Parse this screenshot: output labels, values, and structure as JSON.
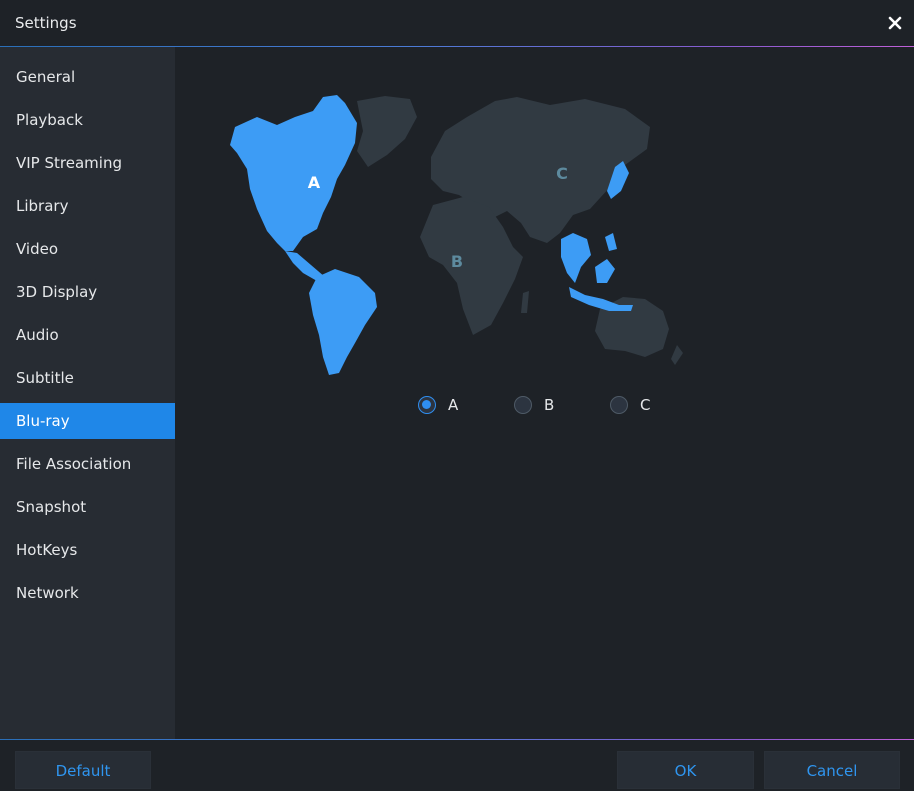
{
  "window": {
    "title": "Settings"
  },
  "sidebar": {
    "items": [
      {
        "label": "General"
      },
      {
        "label": "Playback"
      },
      {
        "label": "VIP Streaming"
      },
      {
        "label": "Library"
      },
      {
        "label": "Video"
      },
      {
        "label": "3D Display"
      },
      {
        "label": "Audio"
      },
      {
        "label": "Subtitle"
      },
      {
        "label": "Blu-ray",
        "active": true
      },
      {
        "label": "File Association"
      },
      {
        "label": "Snapshot"
      },
      {
        "label": "HotKeys"
      },
      {
        "label": "Network"
      }
    ]
  },
  "region": {
    "map_labels": {
      "a": "A",
      "b": "B",
      "c": "C"
    },
    "options": [
      {
        "label": "A",
        "checked": true
      },
      {
        "label": "B",
        "checked": false
      },
      {
        "label": "C",
        "checked": false
      }
    ],
    "selected": "A"
  },
  "footer": {
    "default_label": "Default",
    "ok_label": "OK",
    "cancel_label": "Cancel"
  },
  "colors": {
    "accent": "#1f87e8",
    "region_highlight": "#3d9cf5",
    "region_inactive": "#313a42"
  },
  "icons": {
    "close": "close-icon"
  }
}
